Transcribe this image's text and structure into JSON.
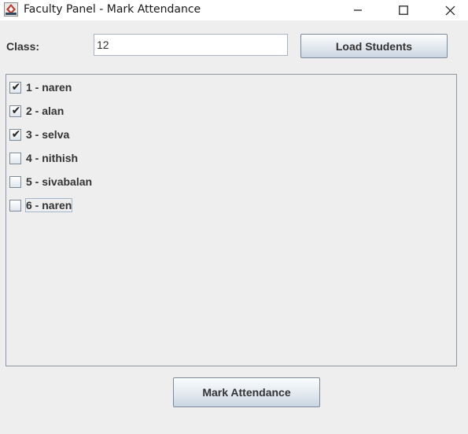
{
  "window": {
    "title": "Faculty Panel - Mark Attendance",
    "icons": {
      "app": "java-app-icon",
      "minimize": "minimize-icon",
      "maximize": "maximize-icon",
      "close": "close-icon"
    }
  },
  "form": {
    "class_label": "Class:",
    "class_value": "12",
    "load_button_label": "Load Students"
  },
  "students": [
    {
      "label": "1 - naren",
      "checked": true
    },
    {
      "label": "2 - alan",
      "checked": true
    },
    {
      "label": "3 - selva",
      "checked": true
    },
    {
      "label": "4 - nithish",
      "checked": false
    },
    {
      "label": "5 - sivabalan",
      "checked": false
    },
    {
      "label": "6 - naren",
      "checked": false
    }
  ],
  "actions": {
    "mark_button_label": "Mark Attendance"
  }
}
